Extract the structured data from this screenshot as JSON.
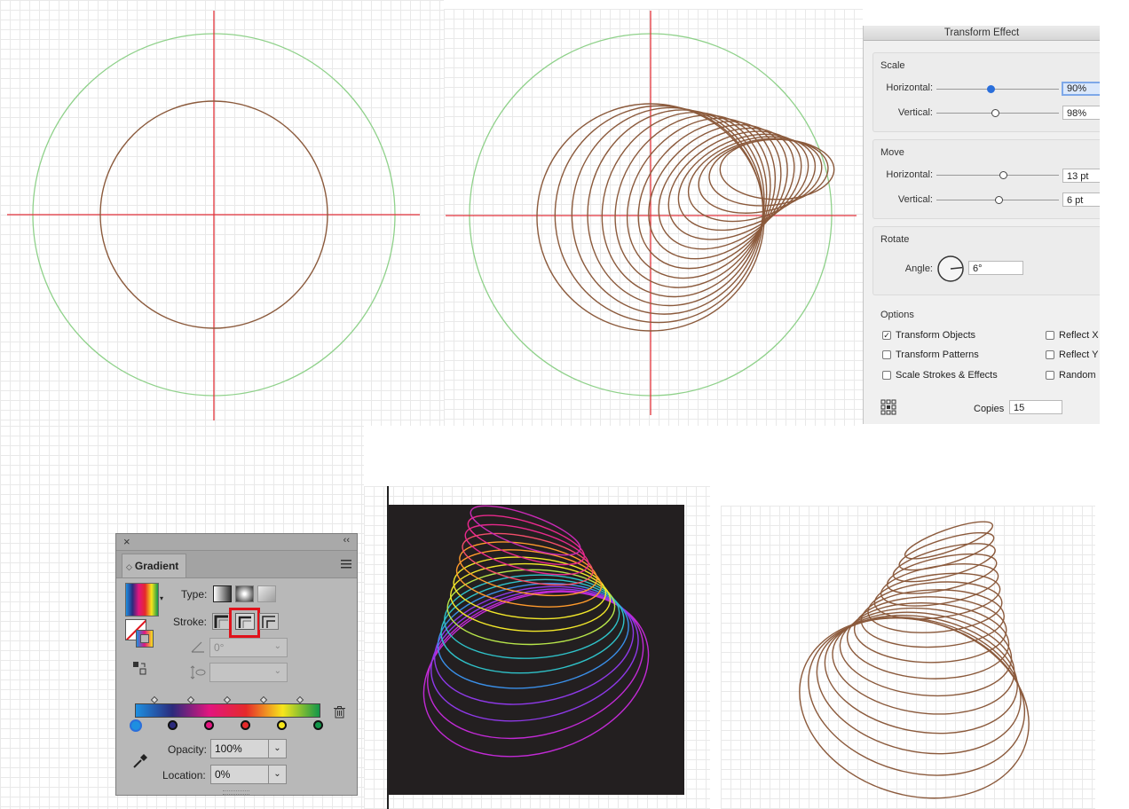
{
  "dialog": {
    "title": "Transform Effect",
    "scale": {
      "title": "Scale",
      "horizontal_label": "Horizontal:",
      "horizontal_value": "90%",
      "vertical_label": "Vertical:",
      "vertical_value": "98%"
    },
    "move": {
      "title": "Move",
      "horizontal_label": "Horizontal:",
      "horizontal_value": "13 pt",
      "vertical_label": "Vertical:",
      "vertical_value": "6 pt"
    },
    "rotate": {
      "title": "Rotate",
      "angle_label": "Angle:",
      "angle_value": "6°"
    },
    "options": {
      "title": "Options",
      "transform_objects": {
        "label": "Transform Objects",
        "checked": true
      },
      "transform_patterns": {
        "label": "Transform Patterns",
        "checked": false
      },
      "scale_strokes": {
        "label": "Scale Strokes & Effects",
        "checked": false
      },
      "reflect_x": {
        "label": "Reflect X",
        "checked": false
      },
      "reflect_y": {
        "label": "Reflect Y",
        "checked": false
      },
      "random": {
        "label": "Random",
        "checked": false
      }
    },
    "copies_label": "Copies",
    "copies_value": "15"
  },
  "gradient_panel": {
    "close_glyph": "×",
    "collapse_glyph": "‹‹",
    "tab_label": "Gradient",
    "type_label": "Type:",
    "stroke_label": "Stroke:",
    "angle_value": "0°",
    "opacity_label": "Opacity:",
    "opacity_value": "100%",
    "location_label": "Location:",
    "location_value": "0%",
    "stop_colors": [
      "#1e8fe0",
      "#2b2a7c",
      "#e2157f",
      "#e52a2a",
      "#f7e61b",
      "#12964a"
    ],
    "icons": [
      "menu-icon",
      "trash-icon",
      "eyedropper-icon",
      "reverse-gradient-icon",
      "angle-icon",
      "aspect-ratio-icon"
    ]
  },
  "colors": {
    "guide_red": "#e2323a",
    "guide_green": "#8fd18a",
    "stroke_brown": "#8b5a3c",
    "dialog_focus": "#2a6fdb",
    "highlight_red": "#e0121b",
    "art_background": "#231f20"
  }
}
